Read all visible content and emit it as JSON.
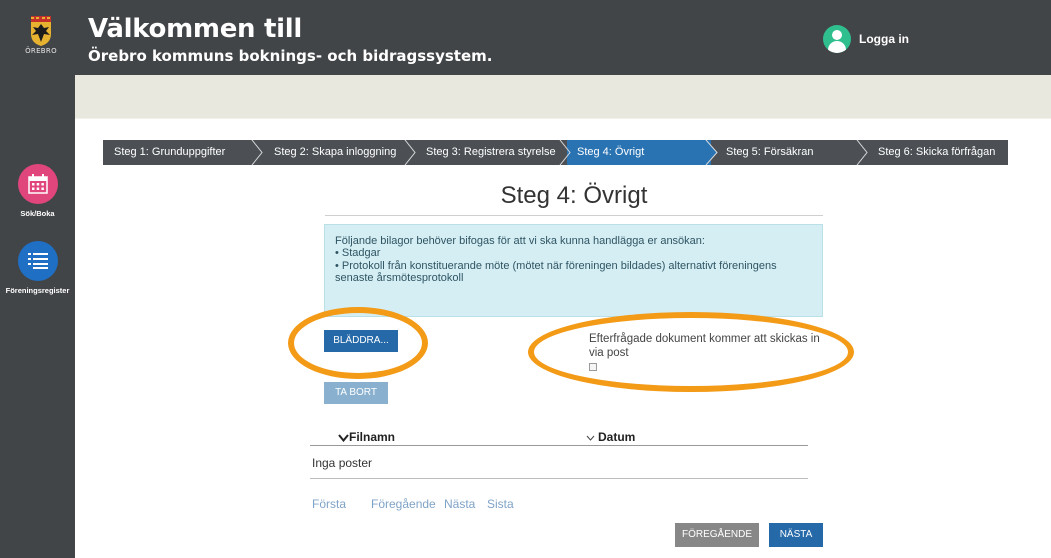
{
  "app": {
    "logo_text": "ÖREBRO",
    "title_line_1": "Välkommen till",
    "title_line_2": "Örebro kommuns boknings- och bidragssystem.",
    "login_label": "Logga in"
  },
  "sidebar": {
    "items": [
      {
        "label": "Sök/Boka",
        "icon": "calendar-icon",
        "color": "#e0457b"
      },
      {
        "label": "Föreningsregister",
        "icon": "list-icon",
        "color": "#1f6fc5"
      }
    ]
  },
  "steps": [
    {
      "label": "Steg 1: Grunduppgifter",
      "active": false
    },
    {
      "label": "Steg 2: Skapa inloggning",
      "active": false
    },
    {
      "label": "Steg 3: Registrera styrelse",
      "active": false
    },
    {
      "label": "Steg 4: Övrigt",
      "active": true
    },
    {
      "label": "Steg 5: Försäkran",
      "active": false
    },
    {
      "label": "Steg 6: Skicka förfrågan",
      "active": false
    }
  ],
  "main": {
    "heading": "Steg 4: Övrigt",
    "info_lines": [
      "Följande bilagor behöver bifogas för att vi ska kunna handlägga er ansökan:",
      "• Stadgar",
      "• Protokoll från konstituerande möte (mötet när föreningen bildades) alternativt föreningens",
      "senaste årsmötesprotokoll"
    ],
    "browse_label": "BLÄDDRA...",
    "remove_label": "TA BORT",
    "mail_note": "Efterfrågade dokument kommer att skickas in via post",
    "mail_checked": false,
    "table": {
      "columns": [
        "Filnamn",
        "Datum"
      ],
      "empty_text": "Inga poster"
    },
    "pager": [
      "Första",
      "Föregående",
      "Nästa",
      "Sista"
    ],
    "prev_label": "FÖREGÅENDE",
    "next_label": "NÄSTA"
  },
  "colors": {
    "header": "#424548",
    "band": "#e9e8de",
    "step_active": "#2a73b3",
    "primary_button": "#2569a8",
    "highlight_ring": "#f39a17"
  }
}
